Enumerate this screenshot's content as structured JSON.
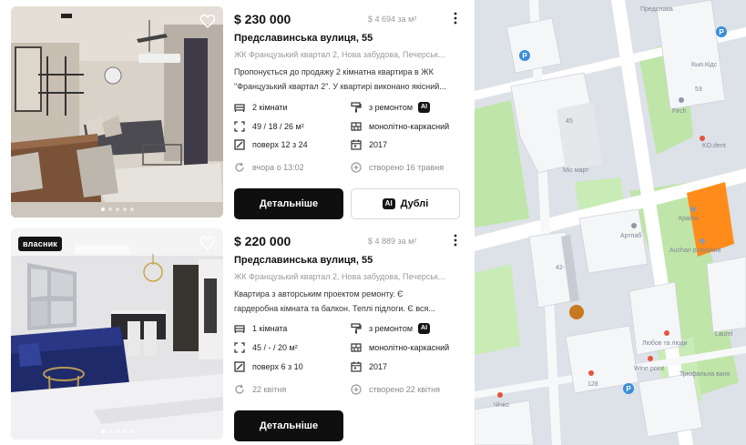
{
  "listings": [
    {
      "owner_badge": "",
      "price": "$ 230 000",
      "price_per_m2": "$ 4 694 за м²",
      "address": "Предславинська вулиця, 55",
      "complex": "ЖК Французький квартал 2, Нова забудова, Печерськ...",
      "description_line1": "Пропонується до продажу 2 кімнатна квартира в ЖК",
      "description_line2": "\"Французький квартал 2\". У квартирі виконано якісний...",
      "rooms": "2 кімнати",
      "area": "49 / 18 / 26 м²",
      "floor": "поверх 12 з 24",
      "updated": "вчора о 13:02",
      "renovation": "з ремонтом",
      "ai_label": "AI",
      "building_type": "монолітно-каркасний",
      "year": "2017",
      "created": "створено 16 травня",
      "details_label": "Детальніше",
      "dubli_label": "Дублі",
      "photo_dots": 5
    },
    {
      "owner_badge": "власник",
      "price": "$ 220 000",
      "price_per_m2": "$ 4 889 за м²",
      "address": "Предславинська вулиця, 55",
      "complex": "ЖК Французький квартал 2, Нова забудова, Печерськ...",
      "description_line1": "Квартира з авторським проектом ремонту. Є",
      "description_line2": "гардеробна кімната та балкон. Теплі підлоги. Є вся...",
      "rooms": "1 кімната",
      "area": "45 / - / 20 м²",
      "floor": "поверх 6 з 10",
      "updated": "22 квітня",
      "renovation": "з ремонтом",
      "ai_label": "AI",
      "building_type": "монолітно-каркасний",
      "year": "2017",
      "created": "створено 22 квітня",
      "details_label": "Детальніше",
      "photo_dots": 5
    }
  ],
  "map": {
    "labels": {
      "street_top": "Предслава",
      "kids": "Кью.Кідс",
      "num_53": "53",
      "num_45": "45",
      "firch": "Firch",
      "ko_dent": "KO.dent",
      "mis_mart": "Міс март",
      "krainia": "Країна",
      "artpub": "Артпаб",
      "auchan": "Auchan розумний",
      "num_42": "42-",
      "laurel": "Laurel",
      "love": "Любов та люди",
      "winepoint": "Wine point",
      "trufalna": "Трюфальна ваня",
      "num_128": "128",
      "chichko": "Чічко"
    },
    "colors": {
      "building": "#f5f6f8",
      "park": "#bfe5a8",
      "road": "#ffffff",
      "highlight": "#ff8c1a",
      "marker": "#c8781e",
      "poi": "#3b8fd9"
    }
  }
}
